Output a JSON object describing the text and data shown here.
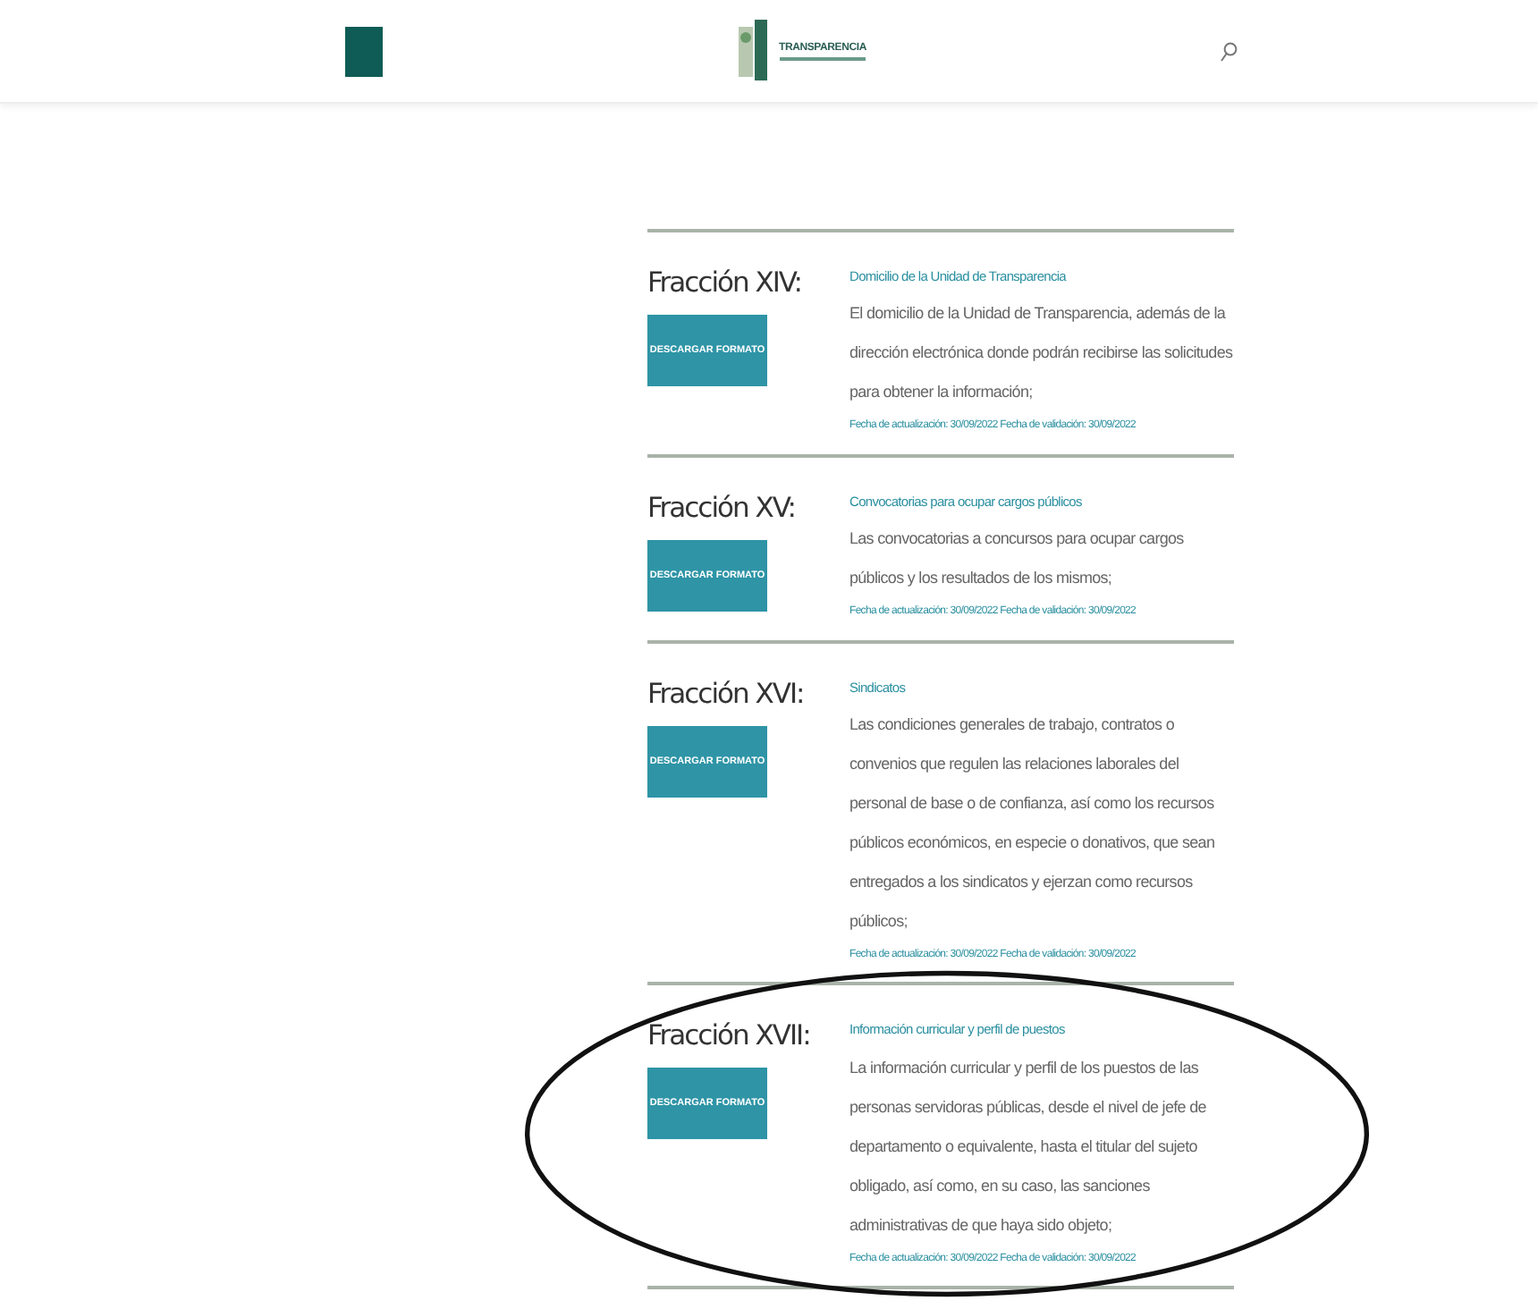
{
  "header": {
    "logo_text": "TRANSPARENCIA"
  },
  "fractions": [
    {
      "title": "Fracción XIV:",
      "button": "DESCARGAR FORMATO",
      "link": "Domicilio de la Unidad de Transparencia",
      "description": "El domicilio de la Unidad de Transparencia, además de la dirección electrónica donde podrán recibirse las solicitudes para obtener la información;",
      "dates": "Fecha de actualización: 30/09/2022 Fecha de validación: 30/09/2022",
      "highlighted": false
    },
    {
      "title": "Fracción XV:",
      "button": "DESCARGAR FORMATO",
      "link": "Convocatorias para ocupar cargos públicos",
      "description": "Las convocatorias a concursos para ocupar cargos públicos y los resultados de los mismos;",
      "dates": "Fecha de actualización: 30/09/2022 Fecha de validación: 30/09/2022",
      "highlighted": false
    },
    {
      "title": "Fracción XVI:",
      "button": "DESCARGAR FORMATO",
      "link": "Sindicatos",
      "description": "Las condiciones generales de trabajo, contratos o convenios que regulen las relaciones laborales del personal de base o de confianza, así como los recursos públicos económicos, en especie o donativos, que sean entregados a los sindicatos y ejerzan como recursos públicos;",
      "dates": "Fecha de actualización: 30/09/2022 Fecha de validación: 30/09/2022",
      "highlighted": false
    },
    {
      "title": "Fracción XVII:",
      "button": "DESCARGAR FORMATO",
      "link": "Información curricular y perfil de puestos",
      "description": "La información curricular y perfil de los puestos de las personas servidoras públicas, desde el nivel de jefe de departamento o equivalente, hasta el titular del sujeto obligado, así como, en su caso, las sanciones administrativas de que haya sido objeto;",
      "dates": "Fecha de actualización: 30/09/2022 Fecha de validación: 30/09/2022",
      "highlighted": true
    }
  ]
}
